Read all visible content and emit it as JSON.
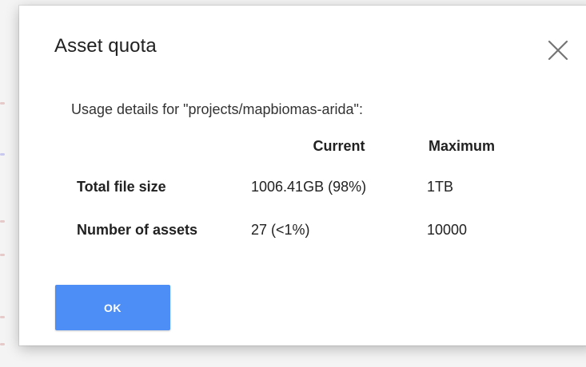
{
  "dialog": {
    "title": "Asset quota",
    "close_icon": "close-icon",
    "usage_line": "Usage details for \"projects/mapbiomas-arida\":"
  },
  "quota_table": {
    "headers": [
      "",
      "Current",
      "Maximum"
    ],
    "rows": [
      {
        "label": "Total file size",
        "current": "1006.41GB (98%)",
        "maximum": "1TB"
      },
      {
        "label": "Number of assets",
        "current": "27 (<1%)",
        "maximum": "10000"
      }
    ]
  },
  "actions": {
    "ok_label": "OK"
  },
  "colors": {
    "primary_button": "#4d8ef6",
    "title_text": "#212121",
    "close_icon": "#757575"
  }
}
